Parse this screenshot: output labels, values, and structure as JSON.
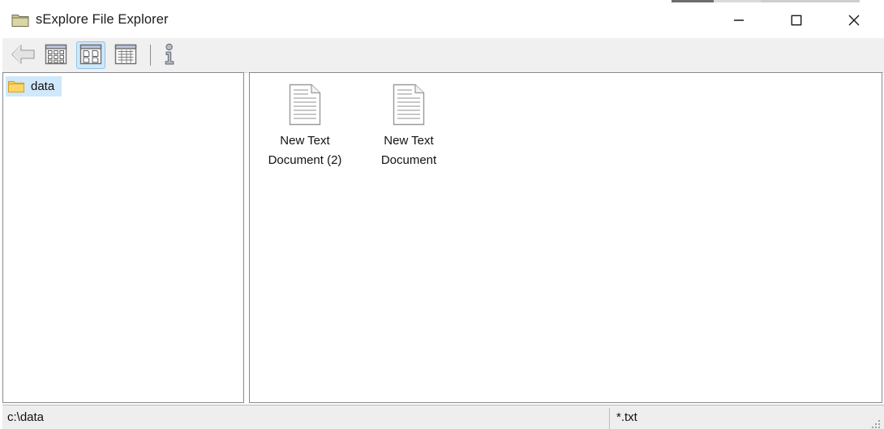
{
  "window": {
    "title": "sExplore File Explorer",
    "title_icon": "folder-icon",
    "controls": {
      "minimize_label": "Minimize",
      "maximize_label": "Maximize",
      "close_label": "Close"
    }
  },
  "toolbar": {
    "items": [
      {
        "name": "back-button",
        "icon": "back-arrow-icon",
        "label": "Back",
        "selected": false,
        "enabled": false
      },
      {
        "name": "view-small-icons-button",
        "icon": "small-icons-view-icon",
        "label": "Small Icons",
        "selected": false,
        "enabled": true
      },
      {
        "name": "view-large-icons-button",
        "icon": "large-icons-view-icon",
        "label": "Large Icons",
        "selected": true,
        "enabled": true
      },
      {
        "name": "view-details-button",
        "icon": "details-view-icon",
        "label": "Details",
        "selected": false,
        "enabled": true
      },
      {
        "name": "info-button",
        "icon": "info-icon",
        "label": "Info",
        "selected": false,
        "enabled": true
      }
    ]
  },
  "tree": {
    "items": [
      {
        "label": "data",
        "icon": "folder-icon",
        "selected": true
      }
    ]
  },
  "files": {
    "items": [
      {
        "label": "New Text Document (2)",
        "icon": "text-document-icon"
      },
      {
        "label": "New Text Document",
        "icon": "text-document-icon"
      }
    ]
  },
  "statusbar": {
    "path": "c:\\data",
    "filter": "*.txt",
    "grip_icon": "resize-grip-icon"
  },
  "colors": {
    "selection": "#cfe8fb",
    "selection_border": "#8fc4e8",
    "toolbar_bg": "#f0f0f0",
    "statusbar_bg": "#eeeeee",
    "pane_border": "#8a8a8e",
    "folder_yellow": "#ffcc4d",
    "title_folder_khaki": "#cdc98f"
  }
}
